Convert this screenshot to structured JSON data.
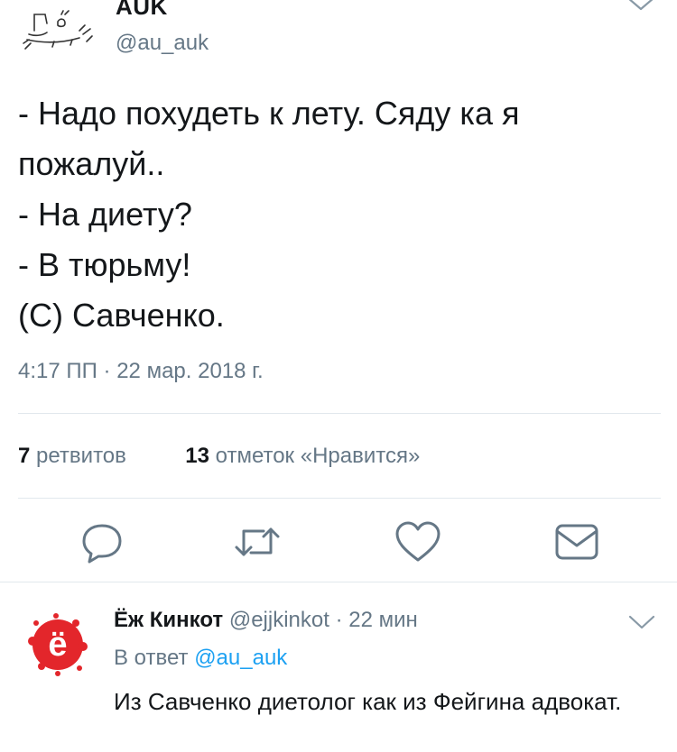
{
  "tweet": {
    "author_name": "AUK",
    "author_handle": "@au_auk",
    "text_lines": [
      "- Надо похудеть к лету. Сяду ка я",
      "пожалуй..",
      "- На диету?",
      "- В тюрьму!",
      "(С) Савченко."
    ],
    "timestamp": "4:17 ПП · 22 мар. 2018 г.",
    "retweets_count": "7",
    "retweets_label": "ретвитов",
    "likes_count": "13",
    "likes_label": "отметок «Нравится»"
  },
  "reply": {
    "author_name": "Ёж Кинкот",
    "author_handle": "@ejjkinkot",
    "separator": "·",
    "time": "22 мин",
    "reply_prefix": "В ответ",
    "reply_to_handle": "@au_auk",
    "text": "Из Савченко диетолог как из Фейгина адвокат.",
    "avatar_letter": "ё"
  },
  "colors": {
    "text": "#14171a",
    "muted": "#657786",
    "link": "#1da1f2",
    "divider": "#e1e8ed",
    "avatar_red": "#e3262b"
  }
}
